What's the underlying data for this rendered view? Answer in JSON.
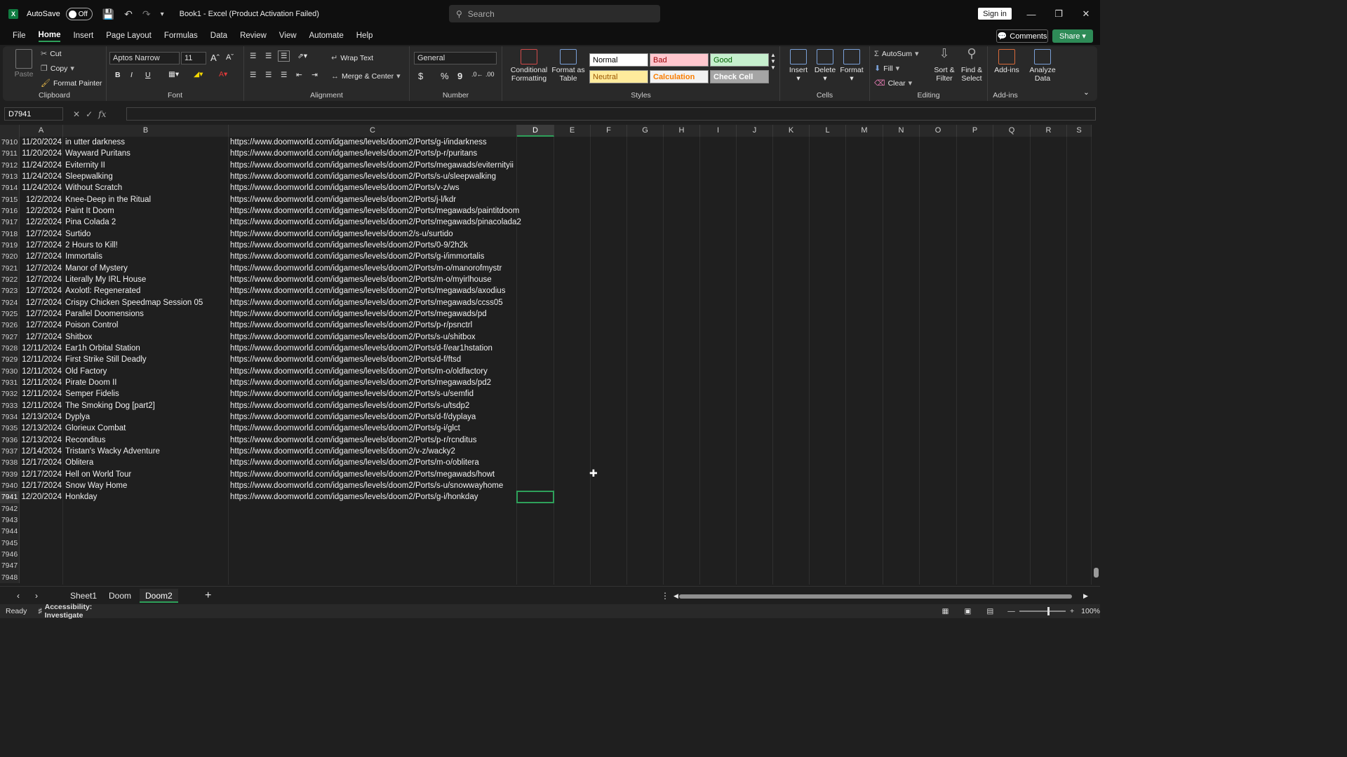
{
  "titlebar": {
    "app_logo": "X",
    "autosave_label": "AutoSave",
    "autosave_state": "Off",
    "document_title": "Book1  -  Excel (Product Activation Failed)",
    "search_placeholder": "Search",
    "signin_label": "Sign in"
  },
  "menu": {
    "items": [
      "File",
      "Home",
      "Insert",
      "Page Layout",
      "Formulas",
      "Data",
      "Review",
      "View",
      "Automate",
      "Help"
    ],
    "active": "Home",
    "comments_label": "Comments",
    "share_label": "Share"
  },
  "ribbon": {
    "clipboard": {
      "paste": "Paste",
      "cut": "Cut",
      "copy": "Copy",
      "format_painter": "Format Painter",
      "label": "Clipboard"
    },
    "font": {
      "font_name": "Aptos Narrow",
      "font_size": "11",
      "bold": "B",
      "italic": "I",
      "underline": "U",
      "label": "Font"
    },
    "alignment": {
      "wrap_text": "Wrap Text",
      "merge_center": "Merge & Center",
      "label": "Alignment"
    },
    "number": {
      "format": "General",
      "currency": "$",
      "percent": "%",
      "comma": "9",
      "label": "Number"
    },
    "styles": {
      "conditional_formatting": "Conditional Formatting",
      "format_as_table": "Format as Table",
      "cells": [
        {
          "name": "Normal",
          "bg": "#ffffff",
          "fg": "#000000"
        },
        {
          "name": "Bad",
          "bg": "#ffc7ce",
          "fg": "#9c0006"
        },
        {
          "name": "Good",
          "bg": "#c6efce",
          "fg": "#006100"
        },
        {
          "name": "Neutral",
          "bg": "#ffeb9c",
          "fg": "#9c5700"
        },
        {
          "name": "Calculation",
          "bg": "#f2f2f2",
          "fg": "#fa7d00"
        },
        {
          "name": "Check Cell",
          "bg": "#a5a5a5",
          "fg": "#ffffff"
        }
      ],
      "label": "Styles"
    },
    "cells": {
      "insert": "Insert",
      "delete": "Delete",
      "format": "Format",
      "label": "Cells"
    },
    "editing": {
      "autosum": "AutoSum",
      "fill": "Fill",
      "clear": "Clear",
      "sort_filter": "Sort & Filter",
      "find_select": "Find & Select",
      "label": "Editing"
    },
    "addins": {
      "addins": "Add-ins",
      "analyze": "Analyze Data",
      "label": "Add-ins"
    }
  },
  "formula_bar": {
    "name_box": "D7941",
    "fx": "fx",
    "formula": ""
  },
  "columns": [
    "A",
    "B",
    "C",
    "D",
    "E",
    "F",
    "G",
    "H",
    "I",
    "J",
    "K",
    "L",
    "M",
    "N",
    "O",
    "P",
    "Q",
    "R",
    "S"
  ],
  "selected_column": "D",
  "rows": [
    {
      "n": "7910",
      "a": "11/20/2024",
      "b": "in utter darkness",
      "c": "https://www.doomworld.com/idgames/levels/doom2/Ports/g-i/indarkness"
    },
    {
      "n": "7911",
      "a": "11/20/2024",
      "b": "Wayward Puritans",
      "c": "https://www.doomworld.com/idgames/levels/doom2/Ports/p-r/puritans"
    },
    {
      "n": "7912",
      "a": "11/24/2024",
      "b": "Eviternity II",
      "c": "https://www.doomworld.com/idgames/levels/doom2/Ports/megawads/eviternityii"
    },
    {
      "n": "7913",
      "a": "11/24/2024",
      "b": "Sleepwalking",
      "c": "https://www.doomworld.com/idgames/levels/doom2/Ports/s-u/sleepwalking"
    },
    {
      "n": "7914",
      "a": "11/24/2024",
      "b": "Without Scratch",
      "c": "https://www.doomworld.com/idgames/levels/doom2/Ports/v-z/ws"
    },
    {
      "n": "7915",
      "a": "12/2/2024",
      "b": "Knee-Deep in the Ritual",
      "c": "https://www.doomworld.com/idgames/levels/doom2/Ports/j-l/kdr"
    },
    {
      "n": "7916",
      "a": "12/2/2024",
      "b": "Paint It Doom",
      "c": "https://www.doomworld.com/idgames/levels/doom2/Ports/megawads/paintitdoom"
    },
    {
      "n": "7917",
      "a": "12/2/2024",
      "b": "Pina Colada 2",
      "c": "https://www.doomworld.com/idgames/levels/doom2/Ports/megawads/pinacolada2"
    },
    {
      "n": "7918",
      "a": "12/7/2024",
      "b": "Surtido",
      "c": "https://www.doomworld.com/idgames/levels/doom2/s-u/surtido"
    },
    {
      "n": "7919",
      "a": "12/7/2024",
      "b": "2 Hours to Kill!",
      "c": "https://www.doomworld.com/idgames/levels/doom2/Ports/0-9/2h2k"
    },
    {
      "n": "7920",
      "a": "12/7/2024",
      "b": "Immortalis",
      "c": "https://www.doomworld.com/idgames/levels/doom2/Ports/g-i/immortalis"
    },
    {
      "n": "7921",
      "a": "12/7/2024",
      "b": "Manor of Mystery",
      "c": "https://www.doomworld.com/idgames/levels/doom2/Ports/m-o/manorofmystr"
    },
    {
      "n": "7922",
      "a": "12/7/2024",
      "b": "Literally My IRL House",
      "c": "https://www.doomworld.com/idgames/levels/doom2/Ports/m-o/myirlhouse"
    },
    {
      "n": "7923",
      "a": "12/7/2024",
      "b": "Axolotl: Regenerated",
      "c": "https://www.doomworld.com/idgames/levels/doom2/Ports/megawads/axodius"
    },
    {
      "n": "7924",
      "a": "12/7/2024",
      "b": "Crispy Chicken Speedmap Session 05",
      "c": "https://www.doomworld.com/idgames/levels/doom2/Ports/megawads/ccss05"
    },
    {
      "n": "7925",
      "a": "12/7/2024",
      "b": "Parallel Doomensions",
      "c": "https://www.doomworld.com/idgames/levels/doom2/Ports/megawads/pd"
    },
    {
      "n": "7926",
      "a": "12/7/2024",
      "b": "Poison Control",
      "c": "https://www.doomworld.com/idgames/levels/doom2/Ports/p-r/psnctrl"
    },
    {
      "n": "7927",
      "a": "12/7/2024",
      "b": "Shitbox",
      "c": "https://www.doomworld.com/idgames/levels/doom2/Ports/s-u/shitbox"
    },
    {
      "n": "7928",
      "a": "12/11/2024",
      "b": "Ear1h Orbital Station",
      "c": "https://www.doomworld.com/idgames/levels/doom2/Ports/d-f/ear1hstation"
    },
    {
      "n": "7929",
      "a": "12/11/2024",
      "b": "First Strike Still Deadly",
      "c": "https://www.doomworld.com/idgames/levels/doom2/Ports/d-f/ftsd"
    },
    {
      "n": "7930",
      "a": "12/11/2024",
      "b": "Old Factory",
      "c": "https://www.doomworld.com/idgames/levels/doom2/Ports/m-o/oldfactory"
    },
    {
      "n": "7931",
      "a": "12/11/2024",
      "b": "Pirate Doom II",
      "c": "https://www.doomworld.com/idgames/levels/doom2/Ports/megawads/pd2"
    },
    {
      "n": "7932",
      "a": "12/11/2024",
      "b": "Semper Fidelis",
      "c": "https://www.doomworld.com/idgames/levels/doom2/Ports/s-u/semfid"
    },
    {
      "n": "7933",
      "a": "12/11/2024",
      "b": "The Smoking Dog [part2]",
      "c": "https://www.doomworld.com/idgames/levels/doom2/Ports/s-u/tsdp2"
    },
    {
      "n": "7934",
      "a": "12/13/2024",
      "b": "Dyplya",
      "c": "https://www.doomworld.com/idgames/levels/doom2/Ports/d-f/dyplaya"
    },
    {
      "n": "7935",
      "a": "12/13/2024",
      "b": "Glorieux Combat",
      "c": "https://www.doomworld.com/idgames/levels/doom2/Ports/g-i/glct"
    },
    {
      "n": "7936",
      "a": "12/13/2024",
      "b": "Reconditus",
      "c": "https://www.doomworld.com/idgames/levels/doom2/Ports/p-r/rcnditus"
    },
    {
      "n": "7937",
      "a": "12/14/2024",
      "b": "Tristan's Wacky Adventure",
      "c": "https://www.doomworld.com/idgames/levels/doom2/v-z/wacky2"
    },
    {
      "n": "7938",
      "a": "12/17/2024",
      "b": "Oblitera",
      "c": "https://www.doomworld.com/idgames/levels/doom2/Ports/m-o/oblitera"
    },
    {
      "n": "7939",
      "a": "12/17/2024",
      "b": "Hell on World Tour",
      "c": "https://www.doomworld.com/idgames/levels/doom2/Ports/megawads/howt"
    },
    {
      "n": "7940",
      "a": "12/17/2024",
      "b": "Snow Way Home",
      "c": "https://www.doomworld.com/idgames/levels/doom2/Ports/s-u/snowwayhome"
    },
    {
      "n": "7941",
      "a": "12/20/2024",
      "b": "Honkday",
      "c": "https://www.doomworld.com/idgames/levels/doom2/Ports/g-i/honkday"
    },
    {
      "n": "7942",
      "a": "",
      "b": "",
      "c": ""
    },
    {
      "n": "7943",
      "a": "",
      "b": "",
      "c": ""
    },
    {
      "n": "7944",
      "a": "",
      "b": "",
      "c": ""
    },
    {
      "n": "7945",
      "a": "",
      "b": "",
      "c": ""
    },
    {
      "n": "7946",
      "a": "",
      "b": "",
      "c": ""
    },
    {
      "n": "7947",
      "a": "",
      "b": "",
      "c": ""
    },
    {
      "n": "7948",
      "a": "",
      "b": "",
      "c": ""
    }
  ],
  "selected_row": "7941",
  "sheets": [
    "Sheet1",
    "Doom",
    "Doom2"
  ],
  "active_sheet": "Doom2",
  "status": {
    "ready": "Ready",
    "accessibility": "Accessibility: Investigate",
    "zoom": "100%"
  },
  "colors": {
    "accent": "#2ea05a",
    "excel_green": "#107c41"
  }
}
